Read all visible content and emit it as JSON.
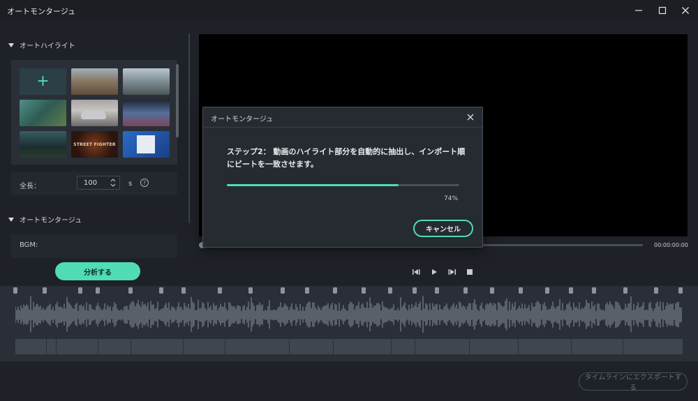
{
  "window": {
    "title": "オートモンタージュ"
  },
  "left": {
    "highlight_section": "オートハイライト",
    "add_symbol": "+",
    "thumbnails": [
      {
        "name": "add-media",
        "color": "#2c3e46"
      },
      {
        "name": "street-scene",
        "color": "#7d6a55"
      },
      {
        "name": "road-scene",
        "color": "#7a8a93"
      },
      {
        "name": "forest-game",
        "color": "#3f6b63"
      },
      {
        "name": "car-scene",
        "color": "#a9a5a3"
      },
      {
        "name": "abstract-lights",
        "color": "#3a4c6d"
      },
      {
        "name": "dark-game",
        "color": "#294347"
      },
      {
        "name": "fighter-logo",
        "color": "#3a1f14",
        "label": "STREET FIGHTER"
      },
      {
        "name": "desktop-screen",
        "color": "#1e4f9a"
      }
    ],
    "duration_label": "全長：",
    "duration_value": "100",
    "duration_unit": "s",
    "help_symbol": "?",
    "montage_section": "オートモンタージュ",
    "bgm_label": "BGM:",
    "analyze_label": "分析する"
  },
  "preview": {
    "timecode": "00:00:00:00"
  },
  "modal": {
    "title": "オートモンタージュ",
    "message": "ステップ2： 動画のハイライト部分を自動的に抽出し、インポート順にビートを一致させます。",
    "progress": 0.74,
    "progress_text": "74%",
    "cancel_label": "キャンセル"
  },
  "footer": {
    "export_label": "タイムラインにエクスポートする"
  },
  "colors": {
    "accent": "#4fdcb7",
    "background": "#1e2127",
    "timeline": "#2a2f37"
  }
}
